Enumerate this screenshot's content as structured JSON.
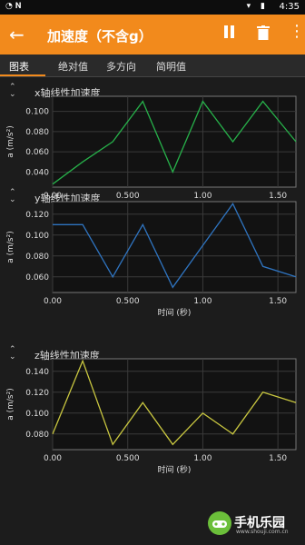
{
  "statusbar": {
    "time": "4:35",
    "app": "◔ 𝐍"
  },
  "appbar": {
    "title": "加速度（不含g）",
    "back_icon": "←",
    "more_icon": "⋮"
  },
  "tabs": [
    {
      "label": "图表"
    },
    {
      "label": "绝对值"
    },
    {
      "label": "多方向"
    },
    {
      "label": "简明值"
    }
  ],
  "colors": {
    "accent": "#f28a1c",
    "x_line": "#27b04a",
    "y_line": "#2f74c0",
    "z_line": "#c9c740"
  },
  "chart_data": [
    {
      "type": "line",
      "title": "x轴线性加速度",
      "xlabel": "时间 (秒)",
      "ylabel": "a (m/s²)",
      "xlim": [
        0,
        1.62
      ],
      "ylim": [
        0.025,
        0.115
      ],
      "xticks": [
        "0.00",
        "0.500",
        "1.00",
        "1.50"
      ],
      "yticks": [
        "0.040",
        "0.060",
        "0.080",
        "0.100"
      ],
      "ytick_values": [
        0.04,
        0.06,
        0.08,
        0.1
      ],
      "x": [
        0,
        0.2,
        0.4,
        0.6,
        0.8,
        1.0,
        1.2,
        1.4,
        1.62
      ],
      "series": [
        {
          "values": [
            0.028,
            0.05,
            0.07,
            0.11,
            0.04,
            0.11,
            0.07,
            0.11,
            0.07
          ]
        }
      ]
    },
    {
      "type": "line",
      "title": "y轴线性加速度",
      "xlabel": "时间 (秒)",
      "ylabel": "a (m/s²)",
      "xlim": [
        0,
        1.62
      ],
      "ylim": [
        0.045,
        0.132
      ],
      "xticks": [
        "0.00",
        "0.500",
        "1.00",
        "1.50"
      ],
      "yticks": [
        "0.060",
        "0.080",
        "0.100",
        "0.120"
      ],
      "ytick_values": [
        0.06,
        0.08,
        0.1,
        0.12
      ],
      "x": [
        0,
        0.2,
        0.4,
        0.6,
        0.8,
        1.0,
        1.2,
        1.4,
        1.62
      ],
      "series": [
        {
          "values": [
            0.11,
            0.11,
            0.06,
            0.11,
            0.05,
            0.09,
            0.13,
            0.07,
            0.06
          ]
        }
      ]
    },
    {
      "type": "line",
      "title": "z轴线性加速度",
      "xlabel": "时间 (秒)",
      "ylabel": "a (m/s²)",
      "xlim": [
        0,
        1.62
      ],
      "ylim": [
        0.065,
        0.152
      ],
      "xticks": [
        "0.00",
        "0.500",
        "1.00",
        "1.50"
      ],
      "yticks": [
        "0.080",
        "0.100",
        "0.120",
        "0.140"
      ],
      "ytick_values": [
        0.08,
        0.1,
        0.12,
        0.14
      ],
      "x": [
        0,
        0.2,
        0.4,
        0.6,
        0.8,
        1.0,
        1.2,
        1.4,
        1.62
      ],
      "series": [
        {
          "values": [
            0.08,
            0.15,
            0.07,
            0.11,
            0.07,
            0.1,
            0.08,
            0.12,
            0.11
          ]
        }
      ]
    }
  ],
  "watermark": {
    "brand": "手机乐园",
    "url": "www.shouji.com.cn"
  }
}
